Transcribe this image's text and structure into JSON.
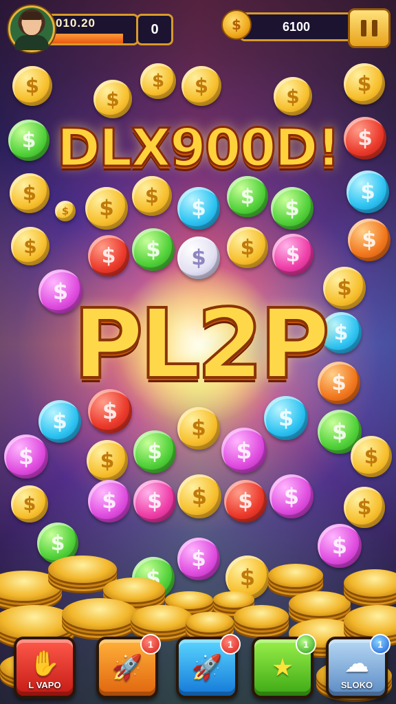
{
  "hud": {
    "xp_text": "010.20",
    "xp_fraction": 0.85,
    "level_value": "0",
    "coin_total": "6100",
    "coin_symbol": "$"
  },
  "titles": {
    "top": "DLX900D!",
    "center": "PL2P"
  },
  "coin_symbol": "$",
  "bottom_bar": {
    "buttons": [
      {
        "name": "hand",
        "label": "L VAPO",
        "badge": null,
        "color": "red"
      },
      {
        "name": "rocket",
        "label": "",
        "badge": "1",
        "color": "orange"
      },
      {
        "name": "rocket-blue",
        "label": "",
        "badge": "1",
        "color": "blue"
      },
      {
        "name": "star",
        "label": "",
        "badge": "1",
        "color": "green"
      },
      {
        "name": "cloud",
        "label": "SLOKO",
        "badge": "1",
        "color": "steel"
      }
    ]
  },
  "colors": {
    "gold": "#f7c02e",
    "green": "#52d23a",
    "red": "#ec3b2c",
    "blue": "#2ec4f2",
    "pink": "#e04ee0",
    "orange": "#f2781e"
  }
}
